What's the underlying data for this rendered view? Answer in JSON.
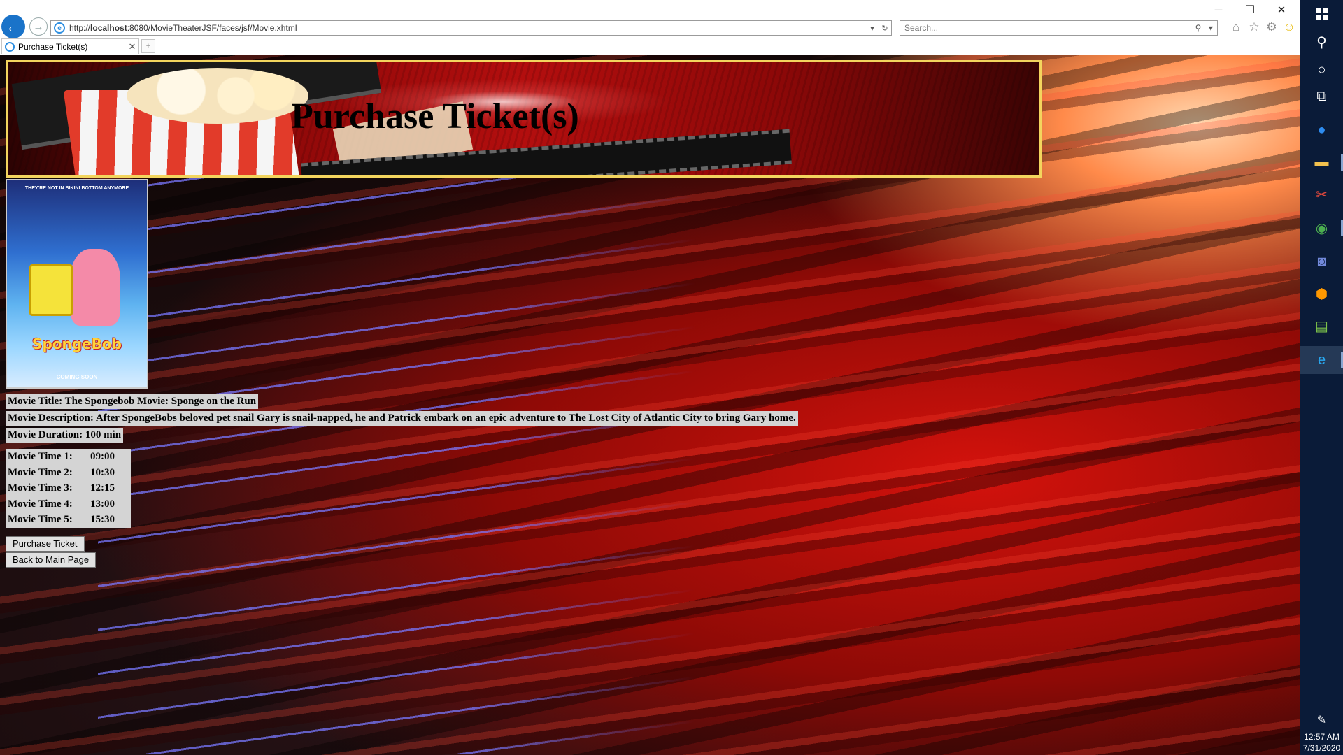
{
  "browser": {
    "url_prefix": "http://",
    "url_host": "localhost",
    "url_rest": ":8080/MovieTheaterJSF/faces/jsf/Movie.xhtml",
    "search_placeholder": "Search...",
    "tab_title": "Purchase Ticket(s)"
  },
  "page": {
    "heading": "Purchase Ticket(s)",
    "poster": {
      "tagline": "THEY'RE NOT IN BIKINI BOTTOM ANYMORE",
      "logo": "SpongeBob",
      "coming_soon": "COMING SOON"
    },
    "movie": {
      "title_label": "Movie Title:",
      "title": "The Spongebob Movie: Sponge on the Run",
      "description_label": "Movie Description:",
      "description": "After SpongeBobs beloved pet snail Gary is snail-napped, he and Patrick embark on an epic adventure to The Lost City of Atlantic City to bring Gary home.",
      "duration_label": "Movie Duration:",
      "duration": "100 min"
    },
    "times": [
      {
        "label": "Movie Time 1:",
        "value": "09:00"
      },
      {
        "label": "Movie Time 2:",
        "value": "10:30"
      },
      {
        "label": "Movie Time 3:",
        "value": "12:15"
      },
      {
        "label": "Movie Time 4:",
        "value": "13:00"
      },
      {
        "label": "Movie Time 5:",
        "value": "15:30"
      }
    ],
    "buttons": {
      "purchase": "Purchase Ticket",
      "back": "Back to Main Page"
    }
  },
  "taskbar": {
    "time": "12:57 AM",
    "date": "7/31/2020"
  }
}
